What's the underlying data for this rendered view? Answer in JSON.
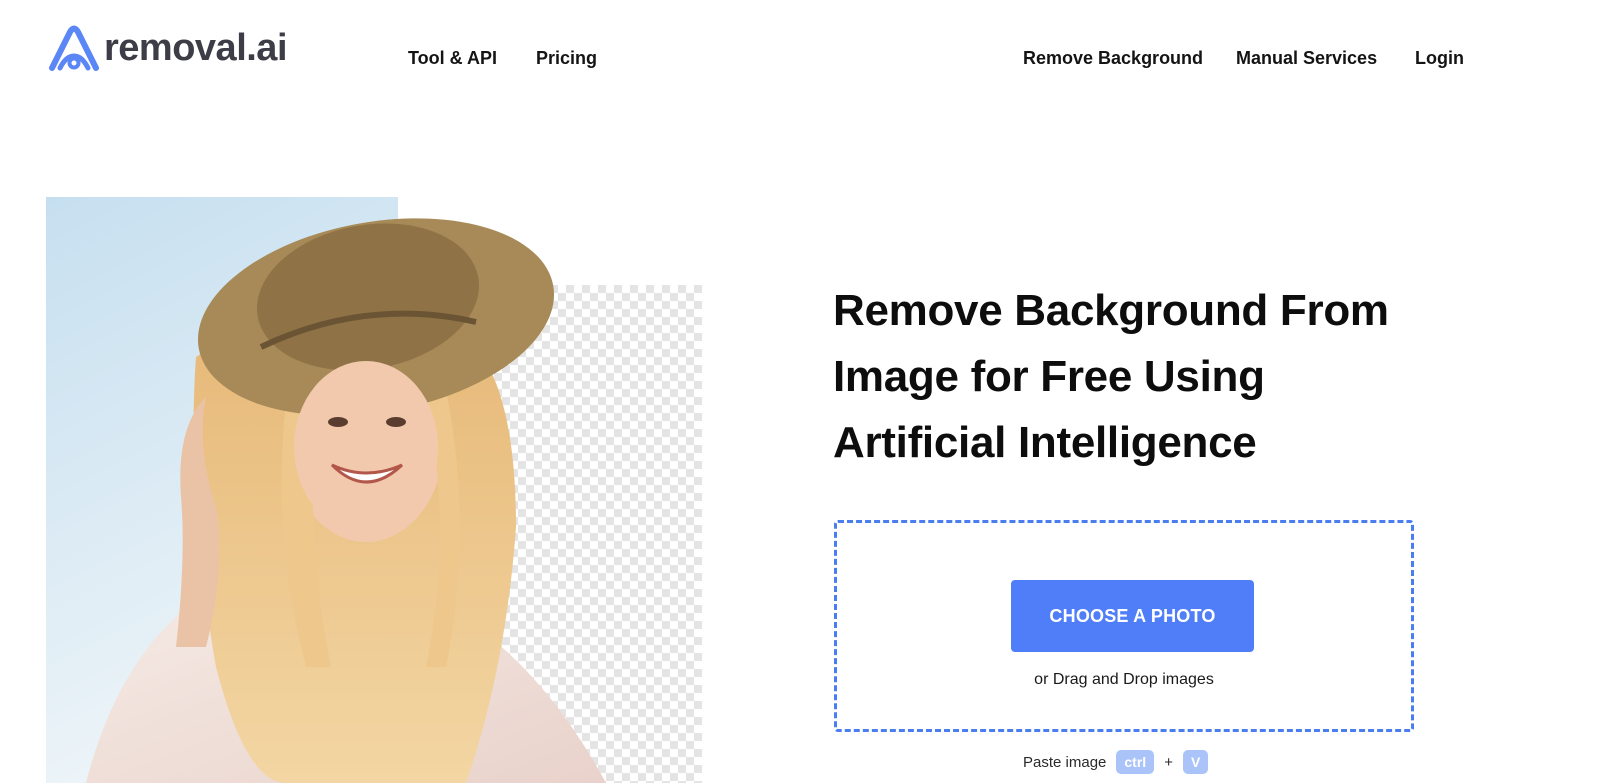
{
  "header": {
    "logo_text": "removal.ai",
    "nav_left": [
      "Tool & API",
      "Pricing"
    ],
    "nav_right": [
      "Remove Background",
      "Manual Services",
      "Login"
    ]
  },
  "hero": {
    "headline_lines": [
      "Remove Background From",
      "Image for Free Using",
      "Artificial Intelligence"
    ],
    "choose_button": "CHOOSE A PHOTO",
    "drag_text": "or Drag and Drop images",
    "paste_label": "Paste image",
    "paste_key1": "ctrl",
    "paste_plus": "+",
    "paste_key2": "V"
  },
  "colors": {
    "accent": "#4f7ef8",
    "dashed_border": "#4a7ef0",
    "key_bg": "#aac4fa",
    "logo_blue": "#5b86f5"
  }
}
